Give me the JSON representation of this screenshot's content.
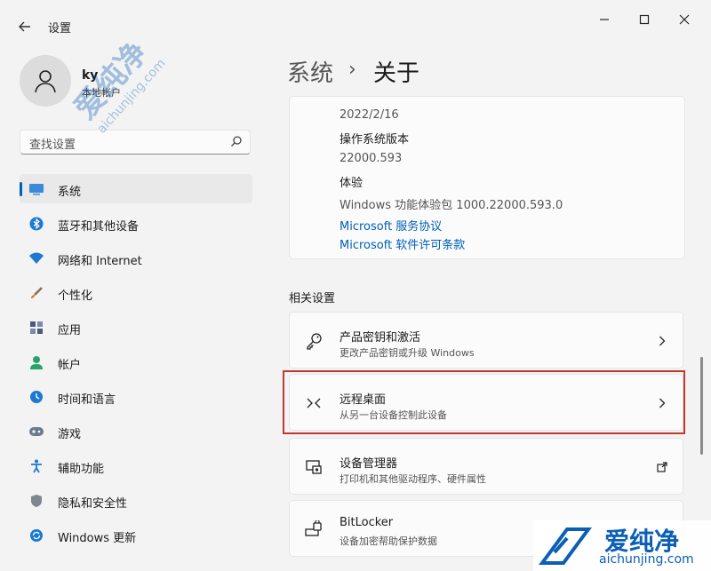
{
  "window": {
    "title": "设置",
    "controls": [
      "minimize-icon",
      "maximize-icon",
      "close-icon"
    ]
  },
  "user": {
    "name": "ky",
    "account_type": "本地帐户"
  },
  "search": {
    "placeholder": "查找设置"
  },
  "nav": {
    "items": [
      {
        "label": "系统",
        "icon": "system-icon",
        "active": true
      },
      {
        "label": "蓝牙和其他设备",
        "icon": "bluetooth-icon"
      },
      {
        "label": "网络和 Internet",
        "icon": "network-icon"
      },
      {
        "label": "个性化",
        "icon": "personalization-icon"
      },
      {
        "label": "应用",
        "icon": "apps-icon"
      },
      {
        "label": "帐户",
        "icon": "accounts-icon"
      },
      {
        "label": "时间和语言",
        "icon": "time-language-icon"
      },
      {
        "label": "游戏",
        "icon": "gaming-icon"
      },
      {
        "label": "辅助功能",
        "icon": "accessibility-icon"
      },
      {
        "label": "隐私和安全性",
        "icon": "privacy-icon"
      },
      {
        "label": "Windows 更新",
        "icon": "windows-update-icon"
      }
    ]
  },
  "breadcrumb": {
    "parent": "系统",
    "separator": "›",
    "current": "关于"
  },
  "specs": {
    "install_date": "2022/2/16",
    "os_build_label": "操作系统版本",
    "os_build": "22000.593",
    "experience_label": "体验",
    "experience": "Windows 功能体验包 1000.22000.593.0",
    "link_services": "Microsoft 服务协议",
    "link_license": "Microsoft 软件许可条款"
  },
  "related": {
    "title": "相关设置",
    "items": [
      {
        "title": "产品密钥和激活",
        "subtitle": "更改产品密钥或升级 Windows",
        "icon": "key-icon",
        "action": "chevron"
      },
      {
        "title": "远程桌面",
        "subtitle": "从另一台设备控制此设备",
        "icon": "remote-desktop-icon",
        "action": "chevron"
      },
      {
        "title": "设备管理器",
        "subtitle": "打印机和其他驱动程序、硬件属性",
        "icon": "device-manager-icon",
        "action": "external"
      },
      {
        "title": "BitLocker",
        "subtitle": "设备加密帮助保护数据",
        "icon": "bitlocker-icon",
        "action": "none"
      }
    ]
  },
  "watermark": {
    "text": "爱纯净",
    "url": "aichunjing.com"
  },
  "colors": {
    "accent": "#005fb8",
    "highlight_border": "#c0392b",
    "background": "#f3f3f3"
  }
}
